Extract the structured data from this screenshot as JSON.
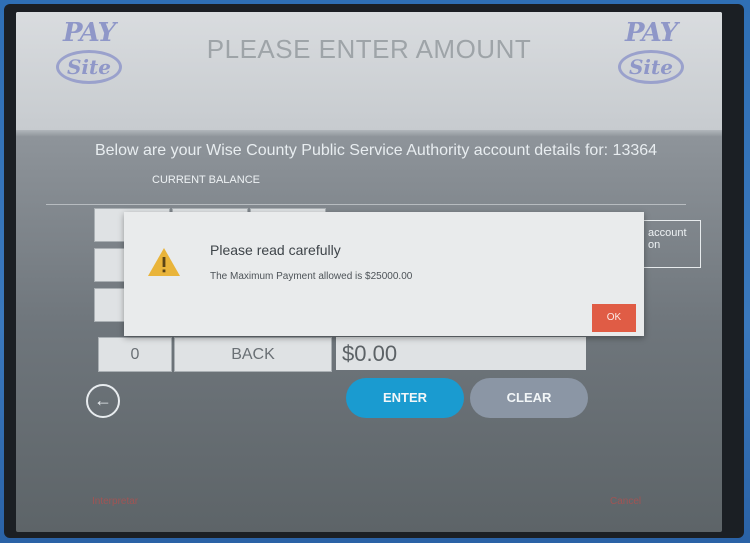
{
  "header": {
    "title": "PLEASE ENTER AMOUNT",
    "logo_left": {
      "pay": "PAY",
      "site": "Site"
    },
    "logo_right": {
      "pay": "PAY",
      "site": "Site"
    }
  },
  "account": {
    "details_text": "Below are your Wise County Public Service Authority account details for: 13364",
    "balance_label": "CURRENT BALANCE",
    "side_box_text": "account\non"
  },
  "keypad": {
    "zero": "0",
    "back": "BACK"
  },
  "amount_display": "$0.00",
  "buttons": {
    "enter": "ENTER",
    "clear": "CLEAR",
    "back_arrow": "←"
  },
  "footer": {
    "left": "Interpretar",
    "right": "Cancel"
  },
  "modal": {
    "heading": "Please read carefully",
    "message": "The Maximum Payment allowed is $25000.00",
    "ok": "OK",
    "icon": "warning-icon"
  },
  "colors": {
    "enter_bg": "#1a9bd0",
    "clear_bg": "#8b96a5",
    "ok_bg": "#e05c45",
    "warning_yellow": "#e9b43a"
  }
}
